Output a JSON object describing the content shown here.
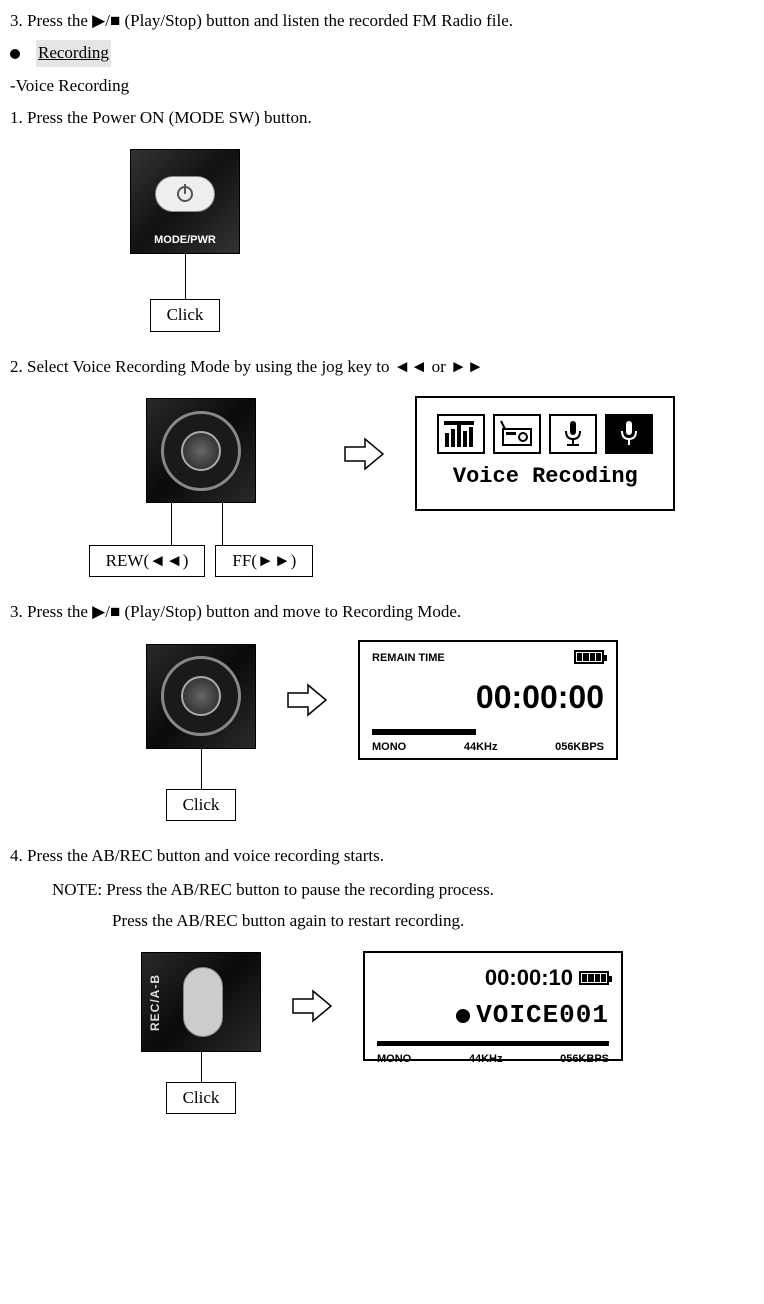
{
  "intro_step": "3. Press the ▶/■ (Play/Stop) button and listen the recorded FM Radio file.",
  "section_title": "Recording",
  "sub_heading": "-Voice Recording",
  "step1": "1.   Press the Power ON (MODE SW) button.",
  "step2": "2.   Select Voice Recording Mode by using the jog key to ◄◄ or ►►",
  "step3": "3.   Press the ▶/■ (Play/Stop) button and move to Recording Mode.",
  "step4": "4. Press the AB/REC button and voice recording starts.",
  "note1": "NOTE: Press the AB/REC button to pause the recording process.",
  "note2": "Press the AB/REC button again to restart recording.",
  "labels": {
    "click": "Click",
    "rew": "REW(◄◄)",
    "ff": "FF(►►)",
    "mode_pwr": "MODE/PWR",
    "rec_ab": "REC/A-B"
  },
  "screens": {
    "voice_recoding": "Voice Recoding",
    "remain": {
      "title": "REMAIN TIME",
      "time": "00:00:00",
      "mono": "MONO",
      "khz": "44KHz",
      "kbps": "056KBPS"
    },
    "voice001": {
      "time": "00:00:10",
      "file": "VOICE001",
      "mono": "MONO",
      "khz": "44KHz",
      "kbps": "056KBPS"
    }
  }
}
